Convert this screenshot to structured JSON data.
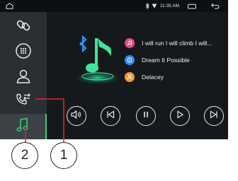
{
  "status_bar": {
    "home_icon": "home-outline-icon",
    "bluetooth_icon": "bluetooth-icon",
    "signal_icon": "signal-icon",
    "time": "11:35 AM",
    "window_icon": "window-icon",
    "back_icon": "back-arrow-icon"
  },
  "sidebar": {
    "items": [
      {
        "name": "bluetooth-pair",
        "icon": "link-icon"
      },
      {
        "name": "dialpad",
        "icon": "dialpad-icon"
      },
      {
        "name": "contacts",
        "icon": "person-icon"
      },
      {
        "name": "call-transfer",
        "icon": "phone-transfer-icon"
      },
      {
        "name": "music",
        "icon": "music-note-icon",
        "selected": true
      }
    ]
  },
  "player": {
    "artwork_icon": "bluetooth-music-icon",
    "tracks": [
      {
        "icon": "music-note-icon",
        "color": "#e84b85",
        "text": "I will run I will climb I will..."
      },
      {
        "icon": "disc-icon",
        "color": "#2f8ef4",
        "text": "Dream It Possible"
      },
      {
        "icon": "person-icon",
        "color": "#f39a35",
        "text": "Delacey"
      }
    ],
    "controls": [
      "volume-icon",
      "previous-icon",
      "pause-icon",
      "play-icon",
      "next-icon"
    ]
  },
  "callouts": [
    {
      "label": "1"
    },
    {
      "label": "2"
    }
  ],
  "colors": {
    "accent": "#37d07c",
    "callout_line": "#e0262a"
  }
}
